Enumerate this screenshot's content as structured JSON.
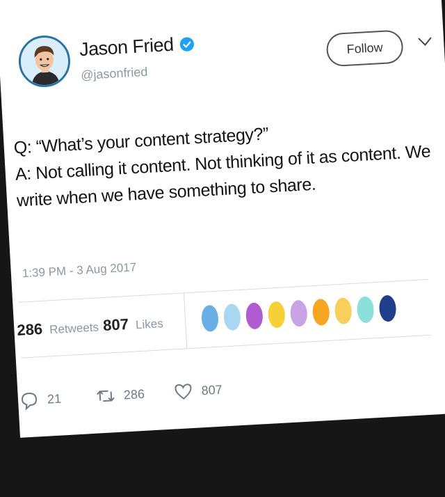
{
  "author": {
    "name": "Jason Fried",
    "handle": "@jasonfried",
    "verified_color": "#1da1f2"
  },
  "header": {
    "follow_label": "Follow"
  },
  "tweet": {
    "lines": [
      "Q: “What’s your content strategy?”",
      "A: Not calling it content. Not thinking of it as content. We",
      "write when we have something to share."
    ],
    "timestamp": "1:39 PM - 3 Aug 2017"
  },
  "stats": {
    "retweets_count": "286",
    "retweets_label": "Retweets",
    "likes_count": "807",
    "likes_label": "Likes"
  },
  "likers": [
    {
      "color": "#6aaee6"
    },
    {
      "color": "#a9d6f0"
    },
    {
      "color": "#b05bd0"
    },
    {
      "color": "#f7cf38"
    },
    {
      "color": "#c8a3e6"
    },
    {
      "color": "#f5a623"
    },
    {
      "color": "#f7cf5a"
    },
    {
      "color": "#8ce0dc"
    },
    {
      "color": "#1f3f8a"
    }
  ],
  "actions": {
    "reply_count": "21",
    "retweet_count": "286",
    "like_count": "807"
  }
}
